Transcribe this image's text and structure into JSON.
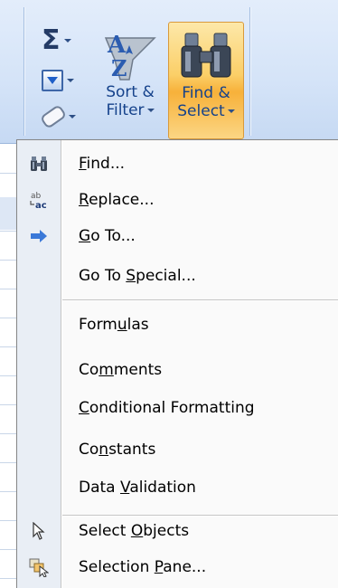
{
  "ribbon": {
    "sort_filter": {
      "line1": "Sort &",
      "line2": "Filter"
    },
    "find_select": {
      "line1": "Find &",
      "line2": "Select"
    },
    "small_buttons": [
      "autosum-icon",
      "fill-icon",
      "clear-icon"
    ]
  },
  "menu": {
    "items": [
      {
        "name": "find",
        "icon": "binoculars-icon",
        "pre": "",
        "key": "F",
        "post": "ind..."
      },
      {
        "name": "replace",
        "icon": "replace-icon",
        "pre": "",
        "key": "R",
        "post": "eplace..."
      },
      {
        "name": "go-to",
        "icon": "arrow-right-icon",
        "pre": "",
        "key": "G",
        "post": "o To..."
      },
      {
        "name": "go-to-special",
        "icon": "",
        "pre": "Go To ",
        "key": "S",
        "post": "pecial..."
      },
      {
        "name": "formulas",
        "icon": "",
        "pre": "Form",
        "key": "u",
        "post": "las"
      },
      {
        "name": "comments",
        "icon": "",
        "pre": "Co",
        "key": "m",
        "post": "ments"
      },
      {
        "name": "conditional-formatting",
        "icon": "",
        "pre": "",
        "key": "C",
        "post": "onditional Formatting"
      },
      {
        "name": "constants",
        "icon": "",
        "pre": "Co",
        "key": "n",
        "post": "stants"
      },
      {
        "name": "data-validation",
        "icon": "",
        "pre": "Data ",
        "key": "V",
        "post": "alidation"
      },
      {
        "name": "select-objects",
        "icon": "cursor-arrow-icon",
        "pre": "Select ",
        "key": "O",
        "post": "bjects"
      },
      {
        "name": "selection-pane",
        "icon": "selection-pane-icon",
        "pre": "Selection ",
        "key": "P",
        "post": "ane..."
      }
    ]
  },
  "colors": {
    "ribbon_label": "#15428b",
    "find_select_highlight": "#fbcf68",
    "menu_gutter": "#e9eef5"
  }
}
